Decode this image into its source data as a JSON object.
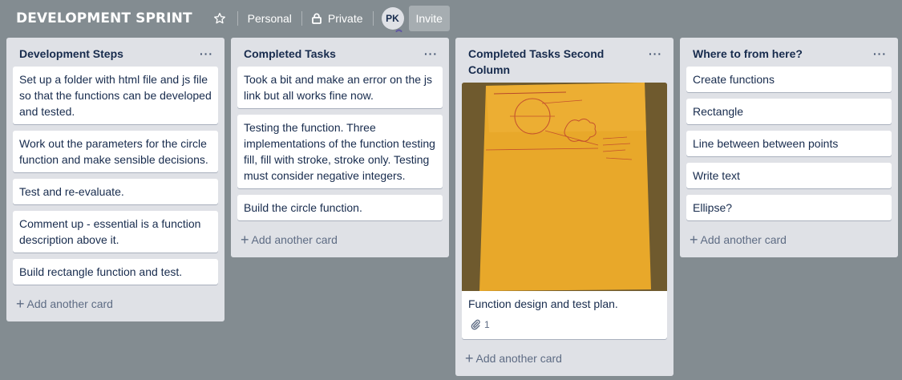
{
  "board": {
    "title": "DEVELOPMENT SPRINT",
    "star_icon": "star-icon",
    "team_label": "Personal",
    "visibility_label": "Private",
    "member_initials": "PK",
    "invite_label": "Invite"
  },
  "lists": [
    {
      "title": "Development Steps",
      "menu": "···",
      "cards": [
        "Set up a folder with html file and js file so that the functions can be developed and tested.",
        "Work out the parameters for the circle function and make sensible decisions.",
        "Test and re-evaluate.",
        "Comment up - essential is a function description above it.",
        "Build rectangle function and test."
      ],
      "add_label": "Add another card"
    },
    {
      "title": "Completed Tasks",
      "menu": "···",
      "cards": [
        "Took a bit and make an error on the js link but all works fine now.",
        "Testing the function. Three implementations of the function testing fill, fill with stroke, stroke only. Testing must consider negative integers.",
        "Build the circle function."
      ],
      "add_label": "Add another card"
    },
    {
      "title": "Completed Tasks Second Column",
      "menu": "···",
      "cards": [
        {
          "text": "Function design and test plan.",
          "attachments": "1",
          "has_cover": true
        }
      ],
      "add_label": "Add another card"
    },
    {
      "title": "Where to from here?",
      "menu": "···",
      "cards": [
        "Create functions",
        "Rectangle",
        "Line between between points",
        "Write text",
        "Ellipse?"
      ],
      "add_label": "Add another card"
    }
  ],
  "colors": {
    "board_bg": "#838c91",
    "list_bg": "#dfe1e6",
    "card_bg": "#ffffff",
    "cover_paper": "#e8a82a"
  }
}
